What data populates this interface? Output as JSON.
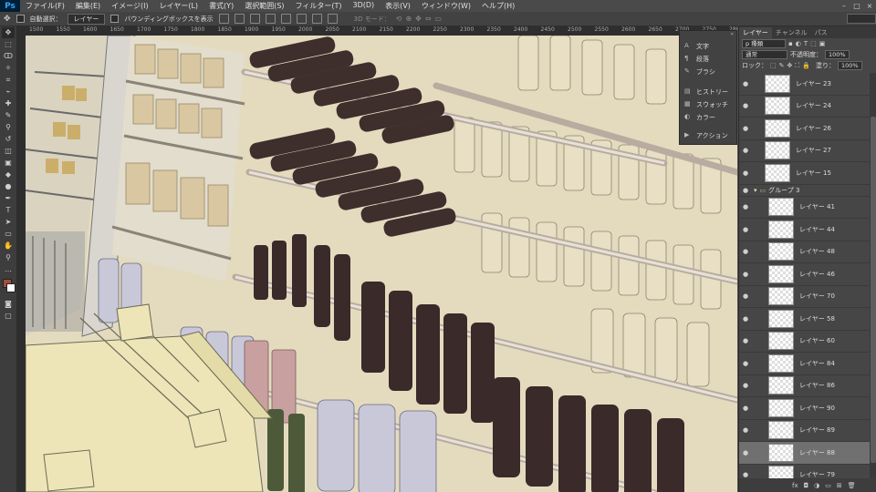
{
  "app": {
    "logo": "Ps"
  },
  "menu": [
    "ファイル(F)",
    "編集(E)",
    "イメージ(I)",
    "レイヤー(L)",
    "書式(Y)",
    "選択範囲(S)",
    "フィルター(T)",
    "3D(D)",
    "表示(V)",
    "ウィンドウ(W)",
    "ヘルプ(H)"
  ],
  "window_controls": [
    "–",
    "□",
    "×"
  ],
  "options": {
    "auto_select_label": "自動選択：",
    "auto_select_value": "レイヤー",
    "bounding_box_label": "バウンディングボックスを表示",
    "mode_3d_label": "3D モード："
  },
  "ruler": {
    "ticks": [
      "1500",
      "1550",
      "1600",
      "1650",
      "1700",
      "1750",
      "1800",
      "1850",
      "1900",
      "1950",
      "2000",
      "2050",
      "2100",
      "2150",
      "2200",
      "2250",
      "2300",
      "2350",
      "2400",
      "2450",
      "2500",
      "2550",
      "2600",
      "2650",
      "2700",
      "2750",
      "2800"
    ]
  },
  "floating_panel": {
    "items": [
      {
        "icon": "A",
        "label": "文字"
      },
      {
        "icon": "¶",
        "label": "段落"
      },
      {
        "icon": "✎",
        "label": "ブラシ"
      },
      {
        "icon": "▤",
        "label": "ヒストリー"
      },
      {
        "icon": "▦",
        "label": "スウォッチ"
      },
      {
        "icon": "◐",
        "label": "カラー"
      },
      {
        "icon": "▶",
        "label": "アクション"
      }
    ]
  },
  "layers_panel": {
    "tabs": [
      "レイヤー",
      "チャンネル",
      "パス"
    ],
    "filter_label": "p 種類",
    "blend_mode": "通常",
    "opacity_label": "不透明度：",
    "opacity_value": "100%",
    "lock_label": "ロック：",
    "fill_label": "塗り：",
    "fill_value": "100%",
    "layers_before_group": [
      "レイヤー 23",
      "レイヤー 24",
      "レイヤー 26",
      "レイヤー 27",
      "レイヤー 15"
    ],
    "group_name": "グループ 3",
    "layers_in_group": [
      "レイヤー 41",
      "レイヤー 44",
      "レイヤー 48",
      "レイヤー 46",
      "レイヤー 70",
      "レイヤー 58",
      "レイヤー 60",
      "レイヤー 84",
      "レイヤー 86",
      "レイヤー 90",
      "レイヤー 89",
      "レイヤー 88",
      "レイヤー 79"
    ],
    "selected_layer": "レイヤー 88",
    "bottom_icons": [
      "fx",
      "◘",
      "◑",
      "▭",
      "⊞",
      "🗑"
    ]
  },
  "colors": {
    "foreground": "#a0503c",
    "background": "#ffffff",
    "canvas_bg": "#e6dcc0"
  }
}
